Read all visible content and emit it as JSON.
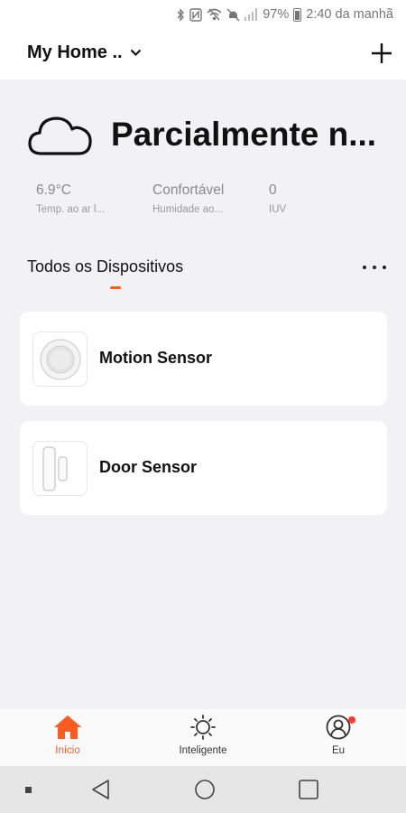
{
  "status_bar": {
    "battery": "97%",
    "time": "2:40 da manhã",
    "icons": [
      "bluetooth-icon",
      "nfc-icon",
      "wifi-icon",
      "mute-icon",
      "signal-icon",
      "battery-icon"
    ]
  },
  "header": {
    "home_name": "My Home ..",
    "icons": [
      "chevron-down-icon",
      "plus-icon"
    ]
  },
  "weather": {
    "icon": "cloud-icon",
    "condition": "Parcialmente n...",
    "metrics": [
      {
        "value": "6.9°C",
        "label": "Temp. ao ar l..."
      },
      {
        "value": "Confortável",
        "label": "Humidade ao..."
      },
      {
        "value": "0",
        "label": "IUV"
      }
    ]
  },
  "devices_section": {
    "title": "Todos os Dispositivos",
    "more_icon": "more-horizontal-icon"
  },
  "devices": [
    {
      "name": "Motion Sensor",
      "icon": "motion-sensor-icon"
    },
    {
      "name": "Door Sensor",
      "icon": "door-sensor-icon"
    }
  ],
  "bottom_tabs": [
    {
      "label": "Início",
      "icon": "home-icon",
      "active": true
    },
    {
      "label": "Inteligente",
      "icon": "sun-icon",
      "active": false
    },
    {
      "label": "Eu",
      "icon": "user-icon",
      "active": false,
      "has_badge": true
    }
  ],
  "nav_bar": {
    "icons": [
      "dot-icon",
      "back-icon",
      "home-circle-icon",
      "recents-icon"
    ]
  },
  "colors": {
    "accent": "#ff5a1f",
    "badge": "#ff3b30",
    "background": "#f2f2f4"
  }
}
